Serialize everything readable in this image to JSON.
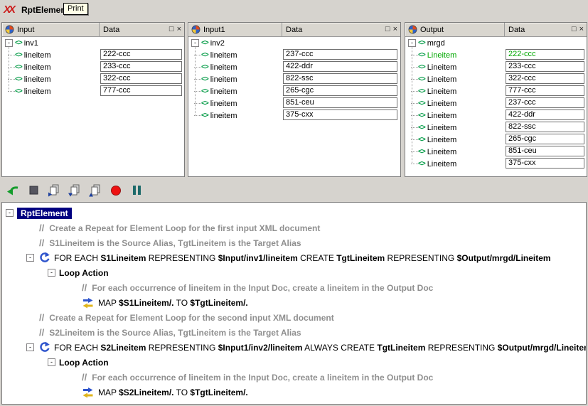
{
  "window": {
    "logo": "XX",
    "title": "RptElemen",
    "tooltip": "Print"
  },
  "icons": {
    "xml": "<>",
    "comment": "//",
    "float": "□",
    "close": "×",
    "collapse": "-"
  },
  "panels": [
    {
      "title": "Input",
      "data_header": "Data",
      "root": "inv1",
      "items": [
        {
          "label": "lineitem",
          "value": "222-ccc"
        },
        {
          "label": "lineitem",
          "value": "233-ccc"
        },
        {
          "label": "lineitem",
          "value": "322-ccc"
        },
        {
          "label": "lineitem",
          "value": "777-ccc"
        }
      ]
    },
    {
      "title": "Input1",
      "data_header": "Data",
      "root": "inv2",
      "items": [
        {
          "label": "lineitem",
          "value": "237-ccc"
        },
        {
          "label": "lineitem",
          "value": "422-ddr"
        },
        {
          "label": "lineitem",
          "value": "822-ssc"
        },
        {
          "label": "lineitem",
          "value": "265-cgc"
        },
        {
          "label": "lineitem",
          "value": "851-ceu"
        },
        {
          "label": "lineitem",
          "value": "375-cxx"
        }
      ]
    },
    {
      "title": "Output",
      "data_header": "Data",
      "root": "mrgd",
      "items": [
        {
          "label": "Lineitem",
          "value": "222-ccc",
          "color": "#00a800"
        },
        {
          "label": "Lineitem",
          "value": "233-ccc"
        },
        {
          "label": "Lineitem",
          "value": "322-ccc"
        },
        {
          "label": "Lineitem",
          "value": "777-ccc"
        },
        {
          "label": "Lineitem",
          "value": "237-ccc"
        },
        {
          "label": "Lineitem",
          "value": "422-ddr"
        },
        {
          "label": "Lineitem",
          "value": "822-ssc"
        },
        {
          "label": "Lineitem",
          "value": "265-cgc"
        },
        {
          "label": "Lineitem",
          "value": "851-ceu"
        },
        {
          "label": "Lineitem",
          "value": "375-cxx"
        }
      ]
    }
  ],
  "toolbar": {
    "icon_names": [
      "execute-icon",
      "stop-icon",
      "step-over-icon",
      "step-into-icon",
      "step-out-icon",
      "record-icon",
      "pause-icon"
    ]
  },
  "rules": {
    "rows": [
      {
        "level": 0,
        "type": "root",
        "expander": true,
        "selected": true,
        "text": "RptElement"
      },
      {
        "level": 1,
        "type": "comment",
        "text": "Create a Repeat for Element Loop for the first input XML document"
      },
      {
        "level": 1,
        "type": "comment",
        "text": "S1Lineitem is the Source Alias, TgtLineitem is the Target Alias"
      },
      {
        "level": 1,
        "type": "foreach",
        "expander": true,
        "segments": [
          {
            "t": "FOR EACH "
          },
          {
            "t": "S1Lineitem",
            "b": true
          },
          {
            "t": " REPRESENTING "
          },
          {
            "t": "$Input/inv1/lineitem",
            "b": true
          },
          {
            "t": " CREATE "
          },
          {
            "t": "TgtLineitem",
            "b": true
          },
          {
            "t": " REPRESENTING "
          },
          {
            "t": "$Output/mrgd/Lineitem",
            "b": true
          }
        ]
      },
      {
        "level": 2,
        "type": "loopaction",
        "expander": true,
        "text": "Loop Action"
      },
      {
        "level": 3,
        "type": "comment",
        "text": "For each occurrence of lineitem in the Input Doc, create a lineitem in the Output Doc"
      },
      {
        "level": 3,
        "type": "map",
        "segments": [
          {
            "t": "MAP "
          },
          {
            "t": "$S1Lineitem/.",
            "b": true
          },
          {
            "t": " TO "
          },
          {
            "t": "$TgtLineitem/.",
            "b": true
          }
        ]
      },
      {
        "level": 1,
        "type": "comment",
        "text": "Create a Repeat for Element Loop for the second input XML document"
      },
      {
        "level": 1,
        "type": "comment",
        "text": "S2Lineitem is the Source Alias, TgtLineitem is the Target Alias"
      },
      {
        "level": 1,
        "type": "foreach",
        "expander": true,
        "segments": [
          {
            "t": "FOR EACH "
          },
          {
            "t": "S2Lineitem",
            "b": true
          },
          {
            "t": " REPRESENTING "
          },
          {
            "t": "$Input1/inv2/lineitem",
            "b": true
          },
          {
            "t": " ALWAYS  CREATE "
          },
          {
            "t": "TgtLineitem",
            "b": true
          },
          {
            "t": " REPRESENTING "
          },
          {
            "t": "$Output/mrgd/Lineitem",
            "b": true
          }
        ]
      },
      {
        "level": 2,
        "type": "loopaction",
        "expander": true,
        "text": "Loop Action"
      },
      {
        "level": 3,
        "type": "comment",
        "text": "For each occurrence of lineitem in the Input Doc, create a lineitem in the Output Doc"
      },
      {
        "level": 3,
        "type": "map",
        "segments": [
          {
            "t": "MAP "
          },
          {
            "t": "$S2Lineitem/.",
            "b": true
          },
          {
            "t": " TO "
          },
          {
            "t": "$TgtLineitem/.",
            "b": true
          }
        ]
      }
    ]
  }
}
